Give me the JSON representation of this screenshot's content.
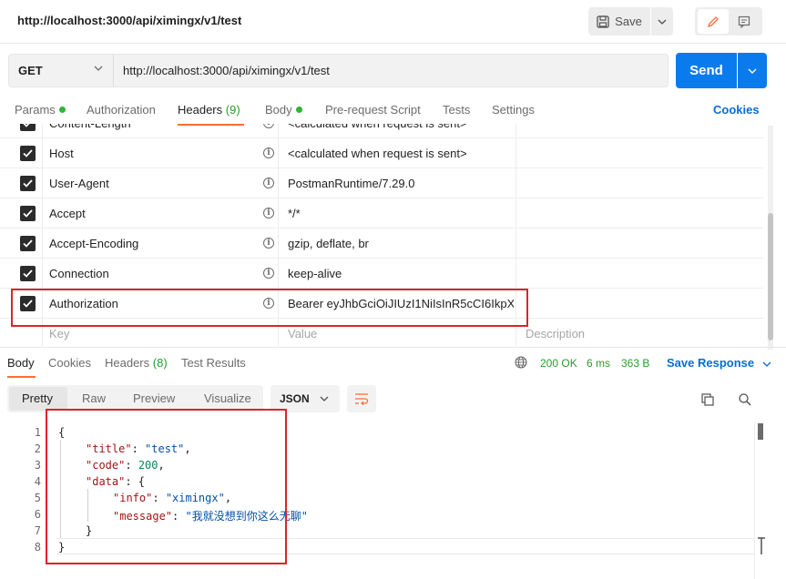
{
  "request": {
    "title": "http://localhost:3000/api/ximingx/v1/test",
    "save_label": "Save",
    "method": "GET",
    "url": "http://localhost:3000/api/ximingx/v1/test",
    "send_label": "Send"
  },
  "request_tabs": {
    "params": "Params",
    "authorization": "Authorization",
    "headers": "Headers",
    "headers_count": "(9)",
    "body": "Body",
    "pre_request": "Pre-request Script",
    "tests": "Tests",
    "settings": "Settings",
    "cookies": "Cookies"
  },
  "headers_table": {
    "rows": [
      {
        "key": "Content-Length",
        "value": "<calculated when request is sent>"
      },
      {
        "key": "Host",
        "value": "<calculated when request is sent>"
      },
      {
        "key": "User-Agent",
        "value": "PostmanRuntime/7.29.0"
      },
      {
        "key": "Accept",
        "value": "*/*"
      },
      {
        "key": "Accept-Encoding",
        "value": "gzip, deflate, br"
      },
      {
        "key": "Connection",
        "value": "keep-alive"
      },
      {
        "key": "Authorization",
        "value": "Bearer eyJhbGciOiJIUzI1NiIsInR5cCI6IkpX..."
      }
    ],
    "key_placeholder": "Key",
    "value_placeholder": "Value",
    "description_placeholder": "Description"
  },
  "response_tabs": {
    "body": "Body",
    "cookies": "Cookies",
    "headers": "Headers",
    "headers_count": "(8)",
    "test_results": "Test Results"
  },
  "response_meta": {
    "status": "200 OK",
    "time": "6 ms",
    "size": "363 B",
    "save_response": "Save Response"
  },
  "format_tabs": {
    "pretty": "Pretty",
    "raw": "Raw",
    "preview": "Preview",
    "visualize": "Visualize",
    "language": "JSON"
  },
  "code": {
    "line_numbers": [
      "1",
      "2",
      "3",
      "4",
      "5",
      "6",
      "7",
      "8"
    ],
    "open_brace": "{",
    "title_key": "\"title\"",
    "title_value": "\"test\"",
    "code_key": "\"code\"",
    "code_value": "200",
    "data_key": "\"data\"",
    "info_key": "\"info\"",
    "info_value": "\"ximingx\"",
    "message_key": "\"message\"",
    "message_value": "\"我就没想到你这么无聊\"",
    "inner_close": "}",
    "close_brace": "}"
  },
  "colors": {
    "accent": "#ff6c37",
    "primary": "#097bed",
    "success": "#2a9a2a",
    "highlight_box": "#d9252b"
  }
}
